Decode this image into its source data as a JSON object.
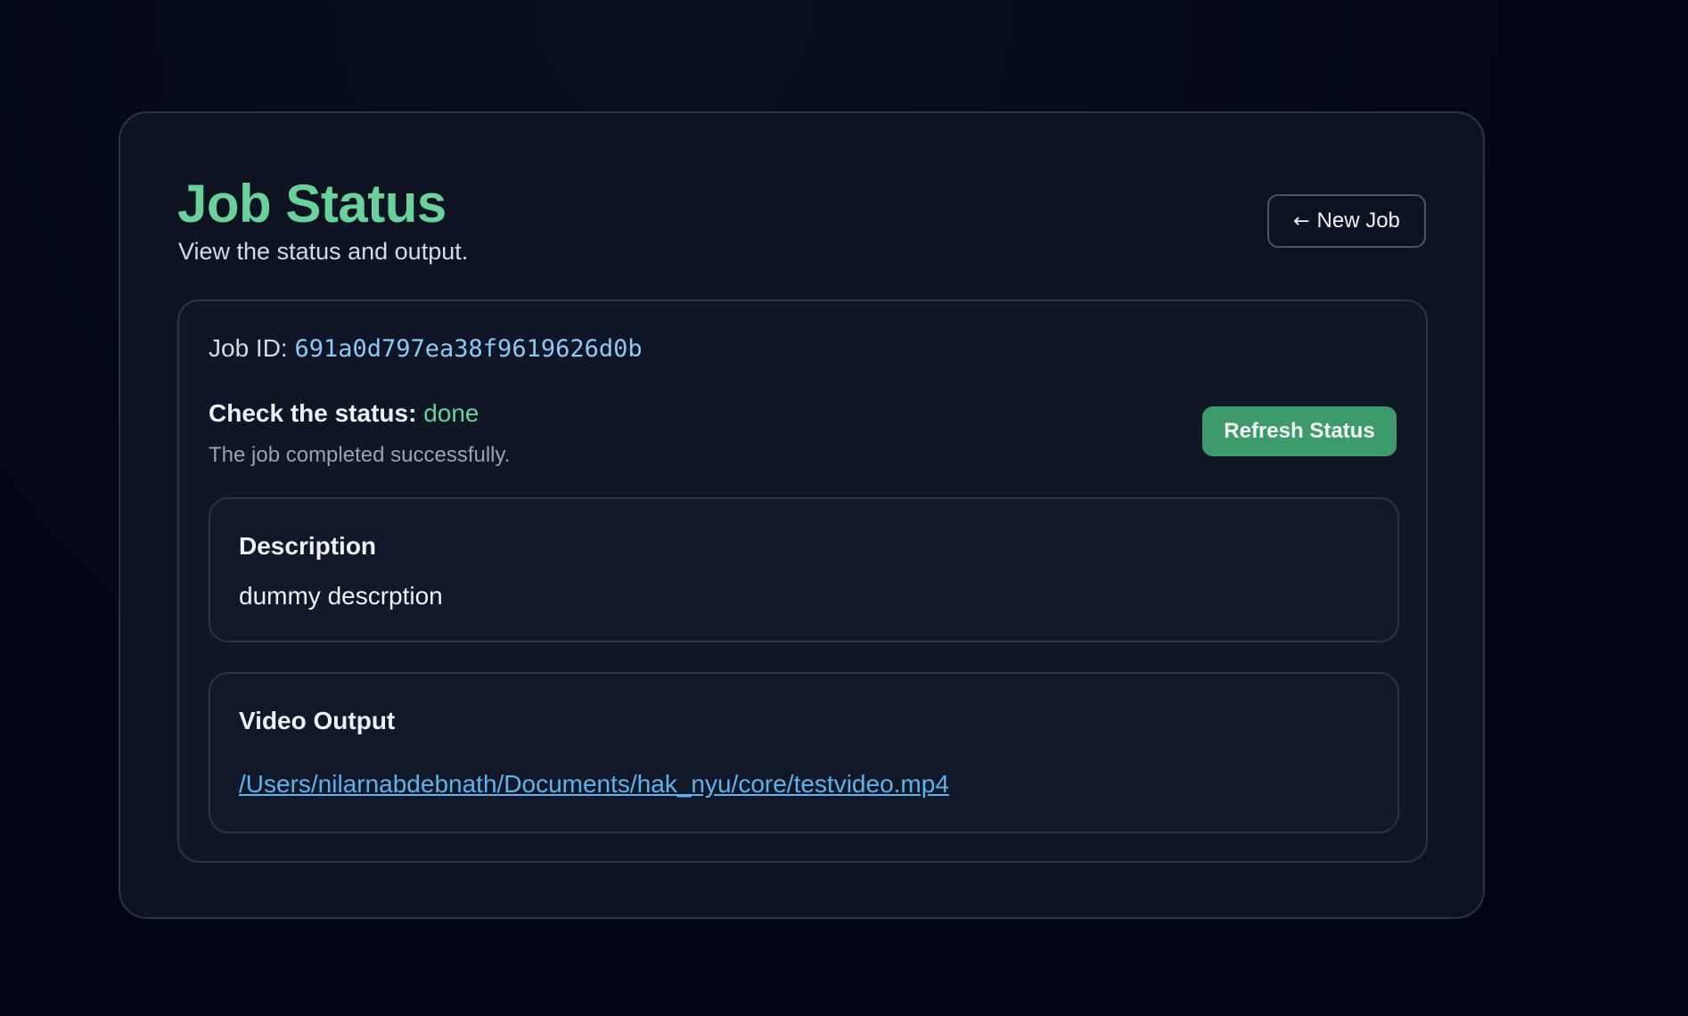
{
  "header": {
    "title": "Job Status",
    "subtitle": "View the status and output.",
    "new_job_arrow": "←",
    "new_job_label": "New Job"
  },
  "job": {
    "id_label": "Job ID:",
    "id_value": "691a0d797ea38f9619626d0b",
    "status_label": "Check the status:",
    "status_value": "done",
    "status_note": "The job completed successfully.",
    "refresh_label": "Refresh Status"
  },
  "description": {
    "title": "Description",
    "text": "dummy descrption"
  },
  "video_output": {
    "title": "Video Output",
    "path": "/Users/nilarnabdebnath/Documents/hak_nyu/core/testvideo.mp4"
  },
  "colors": {
    "accent_green": "#6ad19a",
    "button_green": "#3d9a6a",
    "link_blue": "#5eb2ee",
    "mono_blue": "#8ec9f2",
    "background": "#030712",
    "card": "#0d1322"
  },
  "icons": {
    "new_job_icon": "arrow-left-icon"
  }
}
